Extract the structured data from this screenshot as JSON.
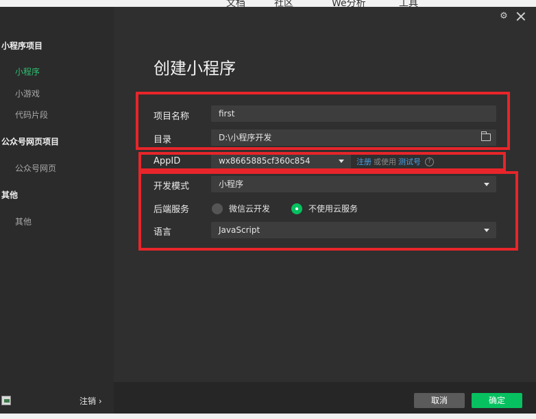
{
  "background_menu": [
    "文档",
    "社区",
    "We分析",
    "工具"
  ],
  "sidebar": {
    "sections": [
      {
        "label": "小程序项目",
        "items": [
          {
            "label": "小程序",
            "active": true
          },
          {
            "label": "小游戏",
            "active": false
          },
          {
            "label": "代码片段",
            "active": false
          }
        ]
      },
      {
        "label": "公众号网页项目",
        "items": [
          {
            "label": "公众号网页",
            "active": false
          }
        ]
      },
      {
        "label": "其他",
        "items": [
          {
            "label": "其他",
            "active": false
          }
        ]
      }
    ],
    "logout_label": "注销 ›"
  },
  "dialog": {
    "title": "创建小程序",
    "project_name_label": "项目名称",
    "project_name_value": "first",
    "directory_label": "目录",
    "directory_value": "D:\\小程序开发",
    "appid_label": "AppID",
    "appid_value": "wx8665885cf360c854",
    "appid_register": "注册",
    "appid_or_use": "或使用",
    "appid_test": "测试号",
    "dev_mode_label": "开发模式",
    "dev_mode_value": "小程序",
    "backend_label": "后端服务",
    "backend_options": [
      "微信云开发",
      "不使用云服务"
    ],
    "backend_selected": "不使用云服务",
    "language_label": "语言",
    "language_value": "JavaScript",
    "cancel_label": "取消",
    "ok_label": "确定"
  },
  "colors": {
    "accent_green": "#07c160",
    "active_text": "#2fbf71",
    "link_blue": "#4aa3e8",
    "highlight_red": "#e8252a"
  }
}
